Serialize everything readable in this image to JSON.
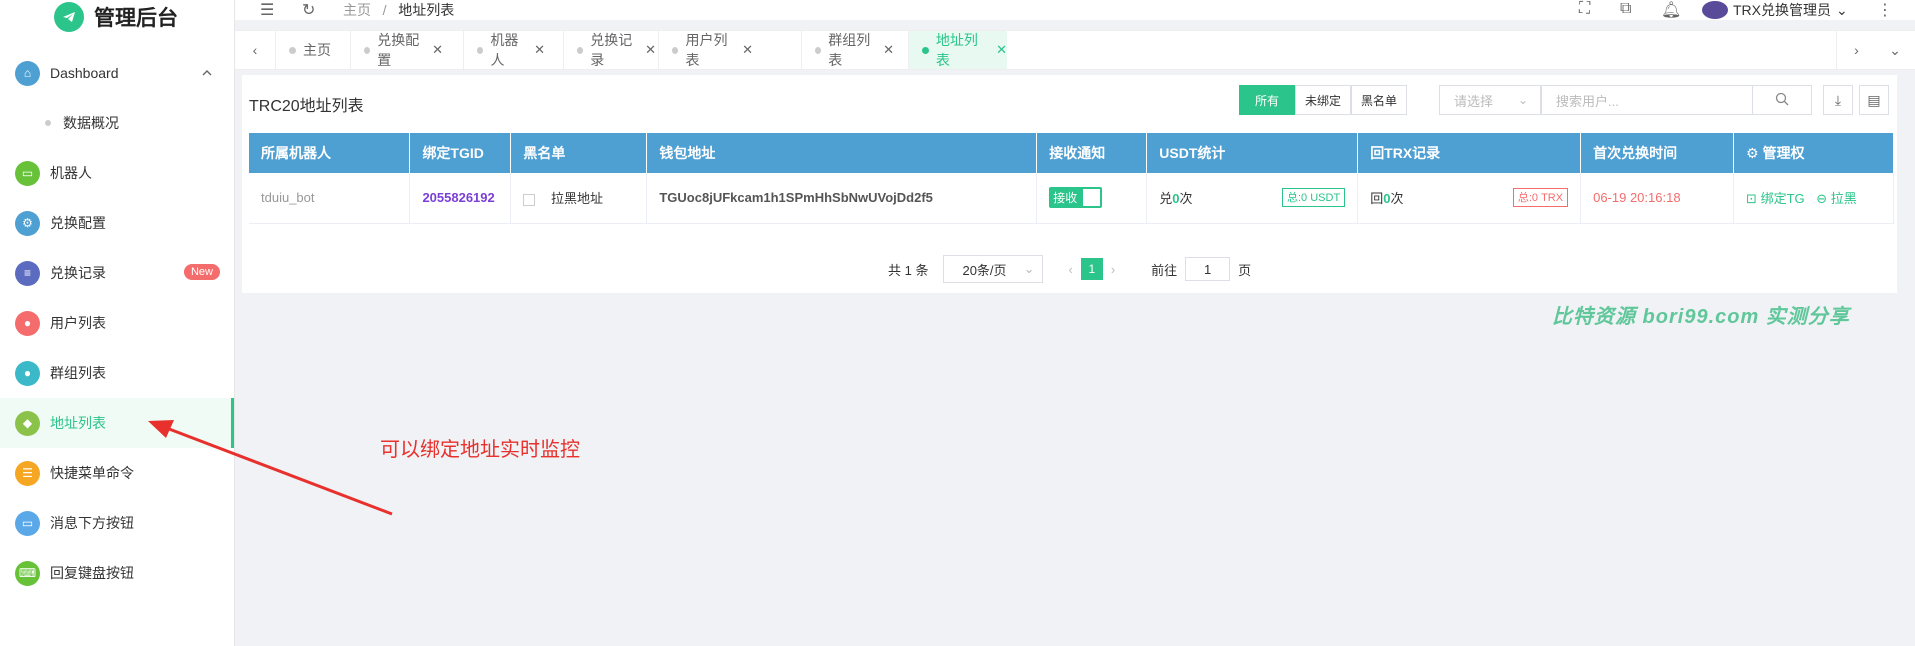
{
  "app": {
    "title": "管理后台"
  },
  "header": {
    "breadcrumb": [
      "主页",
      "地址列表"
    ],
    "breadcrumb_sep": "/",
    "user_name": "TRX兑换管理员"
  },
  "sidebar": {
    "items": [
      {
        "label": "Dashboard",
        "icon": "home-icon",
        "color": "#4e9fd2"
      },
      {
        "label": "机器人",
        "icon": "robot-icon",
        "color": "#67c23a"
      },
      {
        "label": "兑换配置",
        "icon": "settings-icon",
        "color": "#4e9fd2"
      },
      {
        "label": "兑换记录",
        "icon": "document-icon",
        "color": "#5b6bc0",
        "badge": "New"
      },
      {
        "label": "用户列表",
        "icon": "user-icon",
        "color": "#f56c6c"
      },
      {
        "label": "群组列表",
        "icon": "group-icon",
        "color": "#3bb9c9"
      },
      {
        "label": "地址列表",
        "icon": "address-icon",
        "color": "#8bc34a"
      },
      {
        "label": "快捷菜单命令",
        "icon": "menu-command-icon",
        "color": "#f5a623"
      },
      {
        "label": "消息下方按钮",
        "icon": "button-icon",
        "color": "#5aa8e8"
      },
      {
        "label": "回复键盘按钮",
        "icon": "keyboard-icon",
        "color": "#67c23a"
      }
    ],
    "sub_item": "数据概况"
  },
  "tabs": [
    {
      "label": "主页"
    },
    {
      "label": "兑换配置"
    },
    {
      "label": "机器人"
    },
    {
      "label": "兑换记录"
    },
    {
      "label": "用户列表"
    },
    {
      "label": "群组列表"
    },
    {
      "label": "地址列表",
      "active": true
    }
  ],
  "card": {
    "title": "TRC20地址列表",
    "filters": [
      "所有",
      "未绑定",
      "黑名单"
    ],
    "select_placeholder": "请选择",
    "search_placeholder": "搜索用户..."
  },
  "table": {
    "headers": [
      "所属机器人",
      "绑定TGID",
      "黑名单",
      "钱包地址",
      "接收通知",
      "USDT统计",
      "回TRX记录",
      "首次兑换时间",
      "管理权"
    ],
    "row": {
      "bot": "tduiu_bot",
      "tgid": "2055826192",
      "blacklist_label": "拉黑地址",
      "address": "TGUoc8jUFkcam1h1SPmHhSbNwUVojDd2f5",
      "notify": "接收",
      "usdt_prefix": "兑",
      "usdt_count": "0",
      "usdt_suffix": "次",
      "usdt_total": "总:0 USDT",
      "trx_prefix": "回",
      "trx_count": "0",
      "trx_suffix": "次",
      "trx_total": "总:0 TRX",
      "first_time": "06-19 20:16:18",
      "action_bind": "绑定TG",
      "action_block": "拉黑"
    }
  },
  "pagination": {
    "total": "共 1 条",
    "page_size": "20条/页",
    "current": "1",
    "goto_label": "前往",
    "goto_value": "1",
    "page_unit": "页"
  },
  "watermark": "比特资源 bori99.com 实测分享",
  "annotation": "可以绑定地址实时监控"
}
